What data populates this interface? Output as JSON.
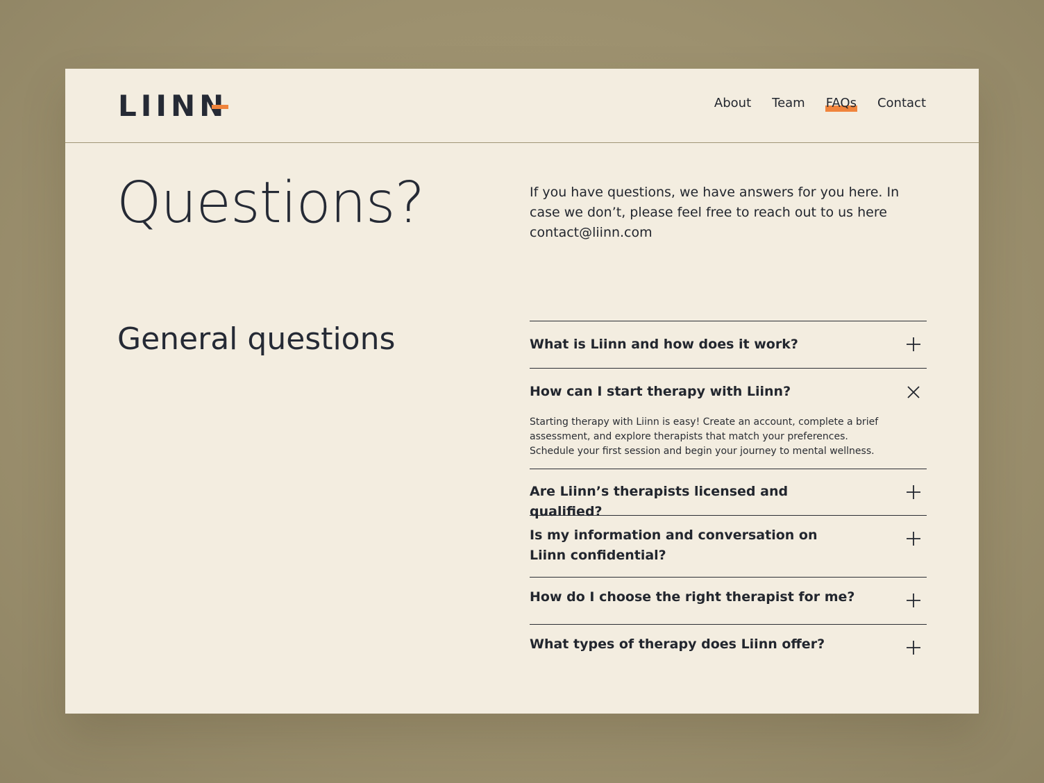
{
  "brand": {
    "logo": "LIINN",
    "accent_color": "#f0843c",
    "text_color": "#252a35",
    "page_background": "#f3ede0"
  },
  "nav": {
    "items": [
      {
        "label": "About",
        "active": false
      },
      {
        "label": "Team",
        "active": false
      },
      {
        "label": "FAQs",
        "active": true
      },
      {
        "label": "Contact",
        "active": false
      }
    ]
  },
  "hero": {
    "title": "Questions?",
    "text": "If you have questions, we have answers for you here. In case we don’t, please feel free to reach out to us here contact@liinn.com"
  },
  "faq": {
    "section_title": "General questions",
    "items": [
      {
        "question": "What is Liinn and how does it work?",
        "expanded": false,
        "icon": "plus-icon"
      },
      {
        "question": "How can I start therapy with Liinn?",
        "expanded": true,
        "icon": "close-icon",
        "answer": "Starting therapy with Liinn is easy! Create an account, complete a brief assessment, and explore therapists that match your preferences. Schedule your first session and begin your journey to mental wellness."
      },
      {
        "question": "Are Liinn’s therapists licensed and qualified?",
        "expanded": false,
        "icon": "plus-icon"
      },
      {
        "question": "Is my information and conversation on Liinn confidential?",
        "expanded": false,
        "icon": "plus-icon"
      },
      {
        "question": "How do I choose the right therapist for me?",
        "expanded": false,
        "icon": "plus-icon"
      },
      {
        "question": "What types of therapy does Liinn offer?",
        "expanded": false,
        "icon": "plus-icon"
      }
    ]
  }
}
